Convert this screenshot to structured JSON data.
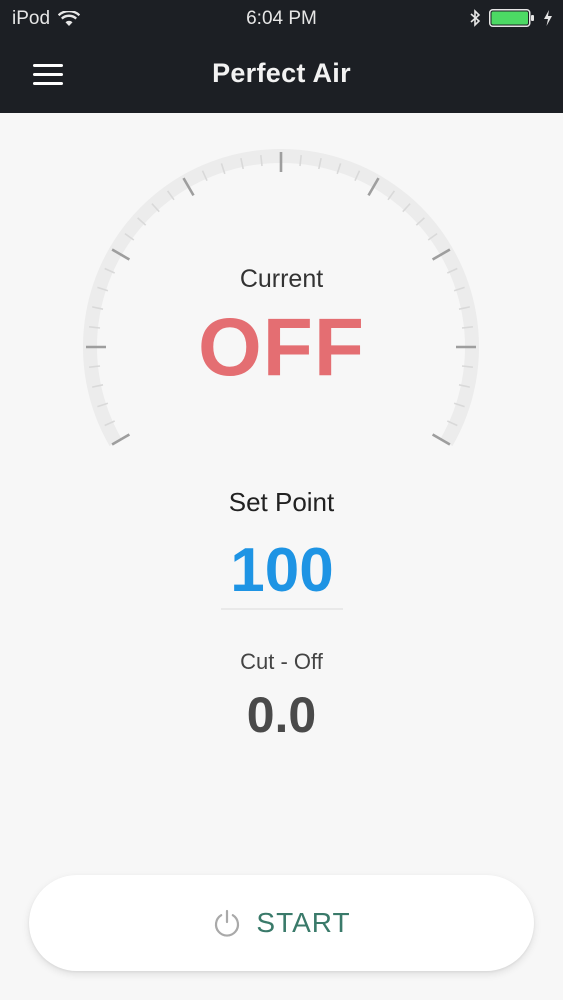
{
  "status": {
    "carrier": "iPod",
    "time": "6:04 PM",
    "wifi_icon": "wifi-icon",
    "bluetooth_icon": "bluetooth-icon",
    "battery_icon": "battery-icon",
    "battery_color": "#4cd964",
    "battery_level": 1.0
  },
  "nav": {
    "title": "Perfect Air",
    "menu_icon": "hamburger-menu-icon"
  },
  "gauge": {
    "current_label": "Current",
    "current_value": "OFF",
    "current_color": "#e46e72",
    "tick_color_light": "#d9d9d9",
    "tick_color_dark": "#9e9e9e"
  },
  "setpoint": {
    "label": "Set Point",
    "value": "100",
    "color": "#1e94e4"
  },
  "cutoff": {
    "label": "Cut - Off",
    "value": "0.0"
  },
  "start_button": {
    "label": "START",
    "icon": "power-icon",
    "label_color": "#3a7a6a"
  },
  "colors": {
    "header_bg": "#1c1f24",
    "page_bg": "#f7f7f7"
  }
}
